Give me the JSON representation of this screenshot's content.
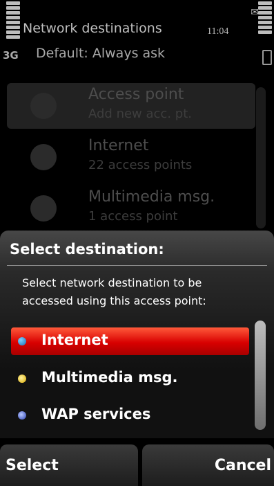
{
  "status_bar": {
    "title": "Network destinations",
    "time": "11:04",
    "network_type": "3G",
    "default_setting": "Default: Always ask"
  },
  "background_list": {
    "items": [
      {
        "title": "Access point",
        "subtitle": "Add new acc. pt."
      },
      {
        "title": "Internet",
        "subtitle": "22 access points"
      },
      {
        "title": "Multimedia msg.",
        "subtitle": "1 access point"
      }
    ]
  },
  "dialog": {
    "title": "Select destination:",
    "description": "Select network destination to be accessed using this access point:",
    "options": [
      {
        "label": "Internet",
        "icon": "globe-icon",
        "selected": true
      },
      {
        "label": "Multimedia msg.",
        "icon": "mms-icon",
        "selected": false
      },
      {
        "label": "WAP services",
        "icon": "wap-icon",
        "selected": false
      }
    ]
  },
  "softkeys": {
    "left": "Select",
    "right": "Cancel"
  },
  "colors": {
    "selection": "#d80000",
    "background": "#000000",
    "text": "#ffffff"
  }
}
